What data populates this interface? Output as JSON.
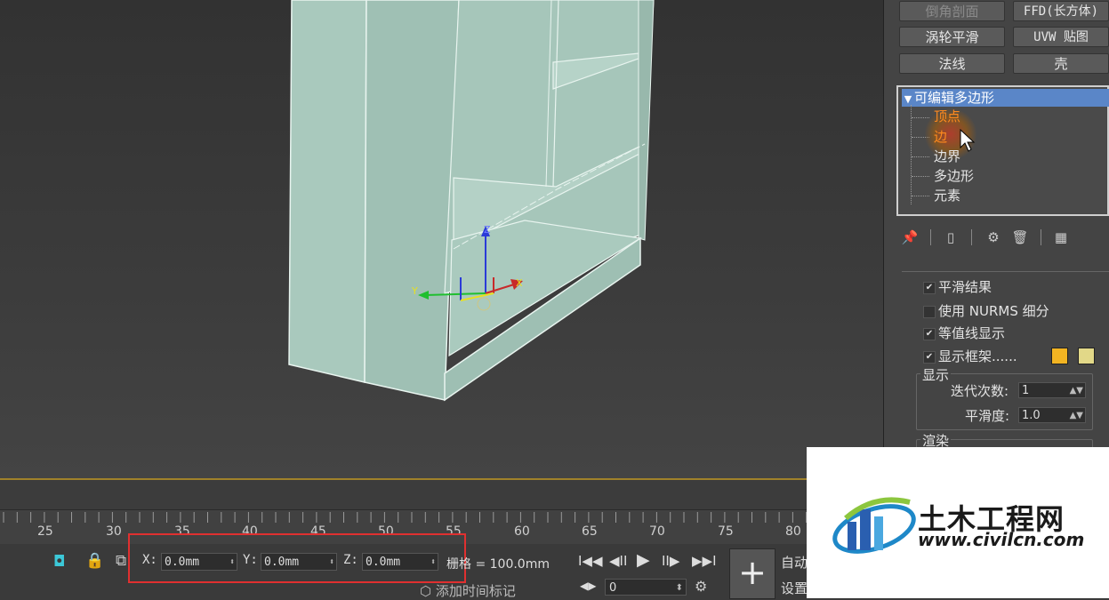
{
  "modifier_buttons": {
    "bevel_profile": "倒角剖面",
    "ffd_box": "FFD(长方体)",
    "turbosmooth": "涡轮平滑",
    "uvw_map": "UVW 贴图",
    "normal": "法线",
    "shell": "壳"
  },
  "stack": {
    "root_label": "可编辑多边形",
    "expand_glyph": "▼",
    "sub_objects": [
      "顶点",
      "边",
      "边界",
      "多边形",
      "元素"
    ]
  },
  "stack_toolbar": {
    "icons": [
      "pin-stack-icon",
      "show-end-result-icon",
      "make-unique-icon",
      "remove-modifier-icon",
      "configure-modifier-sets-icon"
    ]
  },
  "options": {
    "smooth_result": "平滑结果",
    "use_nurms": "使用 NURMS 细分",
    "isoline_display": "等值线显示",
    "show_cage": "显示框架......",
    "cage_color_1": "#f2b422",
    "cage_color_2": "#e2d888"
  },
  "display_group": {
    "title": "显示",
    "iterations_label": "迭代次数:",
    "iterations_value": "1",
    "smoothness_label": "平滑度:",
    "smoothness_value": "1.0"
  },
  "render_group": {
    "title": "渲染"
  },
  "timeline": {
    "ruler_numbers": [
      "25",
      "30",
      "35",
      "40",
      "45",
      "50",
      "55",
      "60",
      "65",
      "70",
      "75",
      "80"
    ]
  },
  "status": {
    "x_label": "X:",
    "x_value": "0.0mm",
    "y_label": "Y:",
    "y_value": "0.0mm",
    "z_label": "Z:",
    "z_value": "0.0mm",
    "grid_text": "栅格 = 100.0mm",
    "add_time_tag": "添加时间标记",
    "frame_value": "0",
    "auto_key": "自动",
    "set_key": "设置"
  },
  "playback": {
    "goto_start": "I◀◀",
    "prev_frame": "◀II",
    "play": "▶",
    "next_frame": "II▶",
    "goto_end": "▶▶I",
    "key_mode": "◀▶"
  },
  "gizmo": {
    "z_label": "Z",
    "y_label": "Y",
    "x_label": "X"
  },
  "watermark": {
    "brand": "土木工程网",
    "url": "www.civilcn.com"
  },
  "colors": {
    "model_fill": "#a3c4b8",
    "stack_highlight": "#5a86c8",
    "sub_active": "#ff8a1e",
    "red_highlight": "#e03030",
    "viewport_border": "#a0822a"
  }
}
